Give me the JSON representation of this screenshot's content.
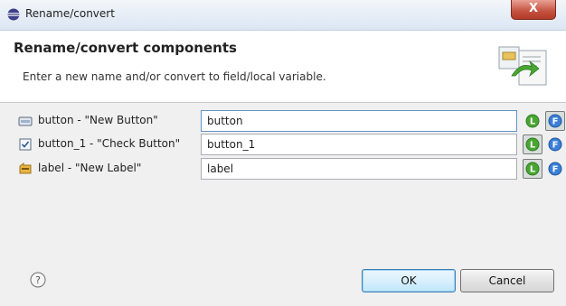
{
  "window": {
    "title": "Rename/convert",
    "close_label": "X"
  },
  "header": {
    "title": "Rename/convert components",
    "description": "Enter a new name and/or convert to field/local variable."
  },
  "rows": [
    {
      "label": "button - \"New Button\"",
      "value": "button",
      "icon": "button-component-icon",
      "local_label": "L",
      "field_label": "F"
    },
    {
      "label": "button_1 - \"Check Button\"",
      "value": "button_1",
      "icon": "checkbox-component-icon",
      "local_label": "L",
      "field_label": "F"
    },
    {
      "label": "label - \"New Label\"",
      "value": "label",
      "icon": "label-component-icon",
      "local_label": "L",
      "field_label": "F"
    }
  ],
  "footer": {
    "help_label": "?",
    "ok_label": "OK",
    "cancel_label": "Cancel"
  },
  "colors": {
    "local_green": "#4aa632",
    "field_blue": "#3b7fd8",
    "close_red": "#c45140"
  }
}
